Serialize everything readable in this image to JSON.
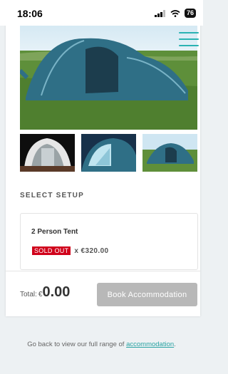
{
  "status_bar": {
    "time": "18:06",
    "battery": "76"
  },
  "gallery": {
    "hero_alt": "Teal tunnel tent pitched on a grassy field",
    "thumbnails": [
      "Tent interior",
      "Tent close-up",
      "Tent on field"
    ]
  },
  "menu": {
    "icon": "hamburger-icon"
  },
  "setup": {
    "title": "SELECT SETUP",
    "option_name": "2 Person Tent",
    "status_badge": "SOLD OUT",
    "price": "x €320.00"
  },
  "total": {
    "label": "Total:",
    "currency": "€",
    "amount": "0.00"
  },
  "book_button": {
    "label": "Book Accommodation"
  },
  "footer": {
    "text": "Go back to view our full range of",
    "link": "accommodation",
    "period": "."
  },
  "colors": {
    "accent": "#2bb3b3",
    "sold_out": "#d0021b",
    "button_disabled": "#b8b8b8"
  }
}
